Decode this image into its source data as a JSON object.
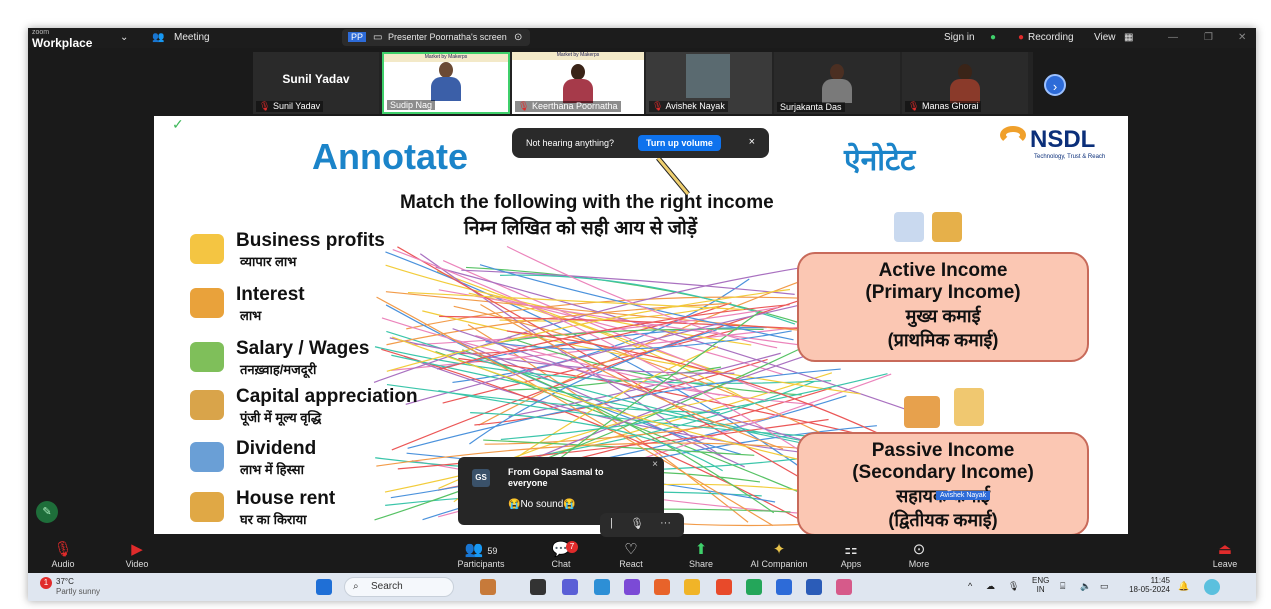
{
  "topbar": {
    "brand_small": "zoom",
    "brand_name": "Workplace",
    "meeting": "Meeting",
    "presenter_initials": "PP",
    "presenter_label": "Presenter Poornatha's screen",
    "sign_in": "Sign in",
    "recording": "Recording",
    "view": "View"
  },
  "gallery": {
    "host_name": "Sunil Yadav",
    "tiles": [
      {
        "name": "Sunil Yadav"
      },
      {
        "name": "Sudip Nag"
      },
      {
        "name": "Keerthana Poornatha"
      },
      {
        "name": "Avishek Nayak"
      },
      {
        "name": "Surjakanta Das"
      },
      {
        "name": "Manas Ghorai"
      }
    ],
    "mini_slide_text": "Market by Makerps"
  },
  "slide": {
    "title_en": "Annotate",
    "title_hi": "ऐनोटेट",
    "logo": "NSDL",
    "logo_tag": "Technology, Trust & Reach",
    "question_en": "Match the following with the right income",
    "question_hi": "निम्न लिखित को सही आय से जोड़ें",
    "items": [
      {
        "en": "Business profits",
        "hi": "व्यापार लाभ"
      },
      {
        "en": "Interest",
        "hi": "लाभ"
      },
      {
        "en": "Salary / Wages",
        "hi": "तनख़्वाह/मजदूरी"
      },
      {
        "en": "Capital appreciation",
        "hi": "पूंजी में मूल्य वृद्धि"
      },
      {
        "en": "Dividend",
        "hi": "लाभ में हिस्सा"
      },
      {
        "en": "House rent",
        "hi": "घर का किराया"
      }
    ],
    "active_box": [
      "Active Income",
      "(Primary Income)",
      "मुख्य कमाई",
      "(प्राथमिक कमाई)"
    ],
    "passive_box": [
      "Passive Income",
      "(Secondary Income)",
      "सहायक कमाई",
      "(द्वितीयक कमाई)"
    ],
    "annotator_badge": "Avishek Nayak"
  },
  "toast": {
    "text": "Not hearing anything?",
    "button": "Turn up volume",
    "close": "×"
  },
  "chat_popup": {
    "initials": "GS",
    "from": "From Gopal Sasmal to everyone",
    "message": "😭No sound😭",
    "close": "×"
  },
  "controls": {
    "audio": "Audio",
    "video": "Video",
    "participants": "Participants",
    "participants_count": "59",
    "chat": "Chat",
    "chat_badge": "7",
    "react": "React",
    "share": "Share",
    "ai_companion": "AI Companion",
    "apps": "Apps",
    "more": "More",
    "leave": "Leave"
  },
  "taskbar": {
    "weather_temp": "37°C",
    "weather_desc": "Partly sunny",
    "weather_badge": "1",
    "search": "Search",
    "lang": "ENG",
    "lang2": "IN",
    "time": "11:45",
    "date": "18-05-2024"
  },
  "colors": {
    "zoom_bg": "#1a1a1a",
    "slide_title": "#1b84c9",
    "box_fill": "#fbc7b3",
    "accent_blue": "#0e72ed",
    "recording_red": "#e02b2b"
  }
}
